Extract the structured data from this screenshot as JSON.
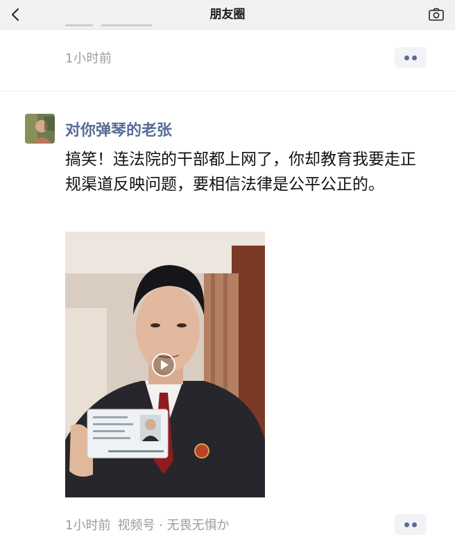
{
  "nav": {
    "title": "朋友圈"
  },
  "prev_post": {
    "time": "1小时前"
  },
  "post": {
    "author": "对你弹琴的老张",
    "text": "搞笑！连法院的干部都上网了，你却教育我要走正规渠道反映问题，要相信法律是公平公正的。",
    "time": "1小时前",
    "channel": "视频号 · 无畏无惧か"
  },
  "colors": {
    "nav_bg": "#f1f1f1",
    "author_link": "#576b95",
    "meta_gray": "#9b9b9b",
    "more_bg": "#f2f3f6"
  },
  "icons": [
    "back-chevron-icon",
    "camera-icon",
    "more-dots-icon",
    "play-icon"
  ]
}
